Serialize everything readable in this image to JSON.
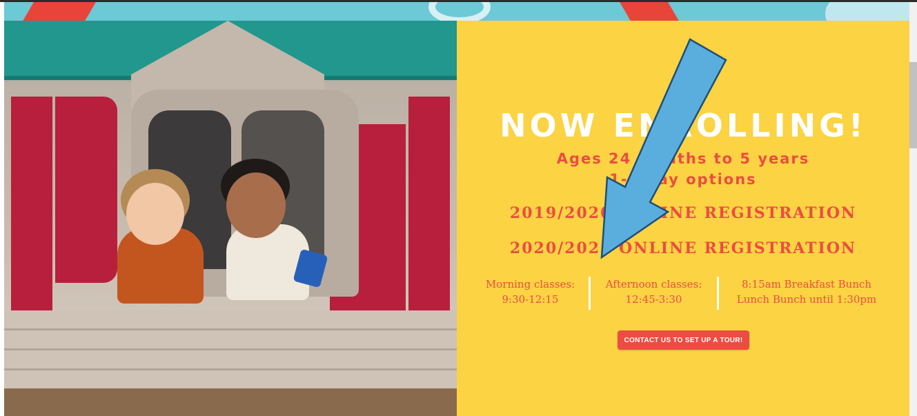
{
  "colors": {
    "panel_yellow": "#fbd343",
    "accent_red": "#ec4c41",
    "headline_white": "#ffffff",
    "banner_teal": "#6cc9d6",
    "arrow_blue": "#5aaede"
  },
  "hero": {
    "headline": "NOW ENROLLING!",
    "ages_line": "Ages 24 months to 5 years",
    "options_line": "1-5 day options",
    "registration_links": [
      "2019/2020 ONLINE REGISTRATION",
      "2020/2021 ONLINE REGISTRATION"
    ],
    "schedule": [
      {
        "line1": "Morning classes:",
        "line2": "9:30-12:15"
      },
      {
        "line1": "Afternoon classes:",
        "line2": "12:45-3:30"
      },
      {
        "line1": "8:15am Breakfast Bunch",
        "line2": "Lunch Bunch until 1:30pm"
      }
    ],
    "tour_button": "CONTACT US TO SET UP A TOUR!"
  },
  "photo": {
    "description_icon": "playhouse-photo"
  },
  "annotation": {
    "icon": "arrow-down-left-icon"
  }
}
